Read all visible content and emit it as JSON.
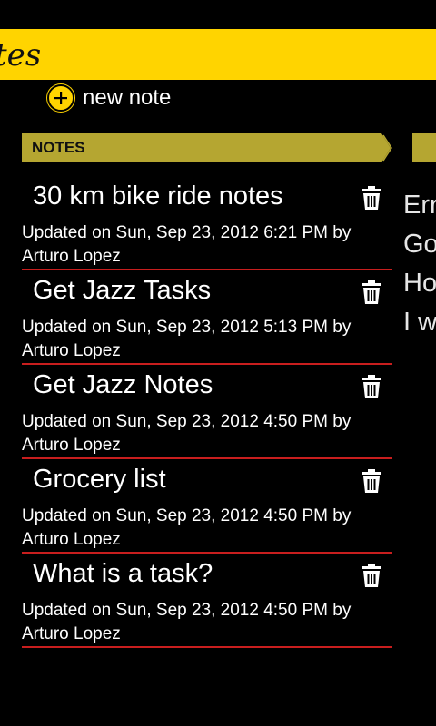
{
  "app": {
    "title": "tes"
  },
  "toolbar": {
    "new_note_label": "new note"
  },
  "section": {
    "header": "NOTES"
  },
  "notes": [
    {
      "title": "30 km bike ride notes",
      "meta_line1": "Updated on Sun, Sep 23, 2012  6:21 PM by",
      "meta_line2": "Arturo Lopez"
    },
    {
      "title": "Get Jazz Tasks",
      "meta_line1": "Updated on Sun, Sep 23, 2012  5:13 PM by",
      "meta_line2": "Arturo Lopez"
    },
    {
      "title": "Get Jazz Notes",
      "meta_line1": "Updated on Sun, Sep 23, 2012  4:50 PM by",
      "meta_line2": "Arturo Lopez"
    },
    {
      "title": "Grocery list",
      "meta_line1": "Updated on Sun, Sep 23, 2012  4:50 PM by",
      "meta_line2": "Arturo Lopez"
    },
    {
      "title": "What is a task?",
      "meta_line1": "Updated on Sun, Sep 23, 2012  4:50 PM by",
      "meta_line2": "Arturo Lopez"
    }
  ],
  "peek": {
    "lines": [
      "Err",
      "Go",
      "Ho",
      "I w"
    ]
  },
  "colors": {
    "accent": "#ffd400",
    "header_olive": "#b5a631",
    "divider_red": "#c81e1e",
    "background": "#000000"
  },
  "icons": {
    "new_note": "plus-circle-icon",
    "delete": "trash-icon",
    "header_chevron": "chevron-right-icon"
  }
}
